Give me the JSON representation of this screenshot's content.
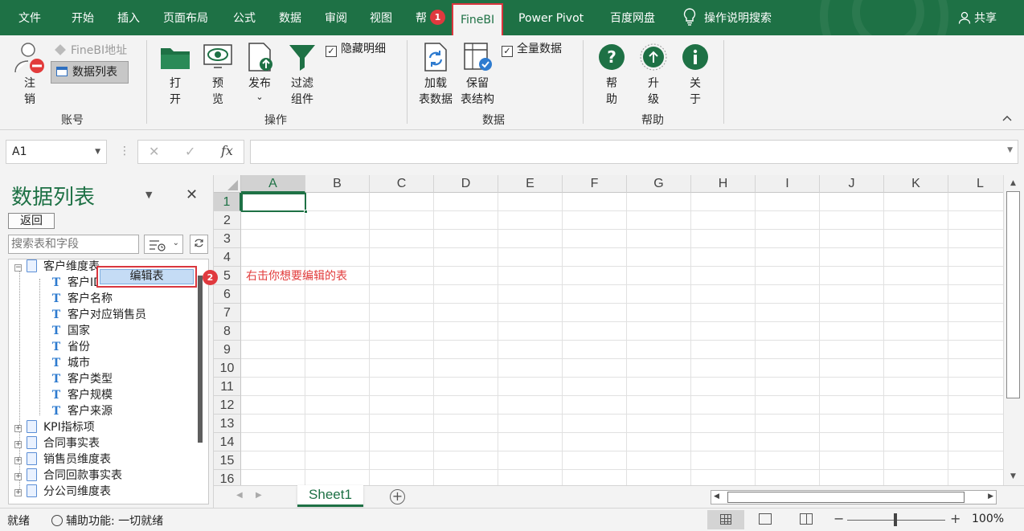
{
  "menubar": {
    "tabs": [
      "文件",
      "开始",
      "插入",
      "页面布局",
      "公式",
      "数据",
      "审阅",
      "视图",
      "帮",
      "FineBI",
      "Power Pivot",
      "百度网盘"
    ],
    "active_tab": "FineBI",
    "badge1": "1",
    "search_label": "操作说明搜索",
    "share_label": "共享"
  },
  "ribbon": {
    "account": {
      "logout_label_1": "注",
      "logout_label_2": "销",
      "finebi_address": "FineBI地址",
      "data_list": "数据列表",
      "group_label": "账号"
    },
    "operations": {
      "open_1": "打",
      "open_2": "开",
      "preview_1": "预",
      "preview_2": "览",
      "publish_1": "发布",
      "publish_2": "⌄",
      "filter_1": "过滤",
      "filter_2": "组件",
      "hide_detail": "隐藏明细",
      "group_label": "操作"
    },
    "data": {
      "load_1": "加载",
      "load_2": "表数据",
      "keep_1": "保留",
      "keep_2": "表结构",
      "full_data": "全量数据",
      "group_label": "数据"
    },
    "help": {
      "help_1": "帮",
      "help_2": "助",
      "upgrade_1": "升",
      "upgrade_2": "级",
      "about_1": "关",
      "about_2": "于",
      "group_label": "帮助"
    }
  },
  "formula": {
    "name_box": "A1",
    "cancel": "✕",
    "confirm": "✓",
    "fx": "fx",
    "value": ""
  },
  "pane": {
    "title": "数据列表",
    "back_button": "返回",
    "search_placeholder": "搜索表和字段",
    "tree": {
      "root": "客户维度表",
      "fields": [
        "客户ID",
        "客户名称",
        "客户对应销售员",
        "国家",
        "省份",
        "城市",
        "客户类型",
        "客户规模",
        "客户来源"
      ],
      "others": [
        "KPI指标项",
        "合同事实表",
        "销售员维度表",
        "合同回款事实表",
        "分公司维度表"
      ]
    },
    "context_menu_item": "编辑表"
  },
  "annotation": {
    "badge2": "2",
    "text": "右击你想要编辑的表"
  },
  "grid": {
    "columns": [
      "A",
      "B",
      "C",
      "D",
      "E",
      "F",
      "G",
      "H",
      "I",
      "J",
      "K",
      "L"
    ],
    "rows": [
      "1",
      "2",
      "3",
      "4",
      "5",
      "6",
      "7",
      "8",
      "9",
      "10",
      "11",
      "12",
      "13",
      "14",
      "15",
      "16"
    ],
    "selected_cell": "A1"
  },
  "sheet_tabs": {
    "sheets": [
      "Sheet1"
    ],
    "add": "+"
  },
  "status": {
    "ready": "就绪",
    "accessibility": "辅助功能: 一切就绪",
    "zoom": "100%",
    "minus": "−",
    "plus": "+"
  },
  "colors": {
    "excel_green": "#1e7145",
    "highlight_red": "#d9363e",
    "tree_icon_blue": "#2e7bcf"
  }
}
